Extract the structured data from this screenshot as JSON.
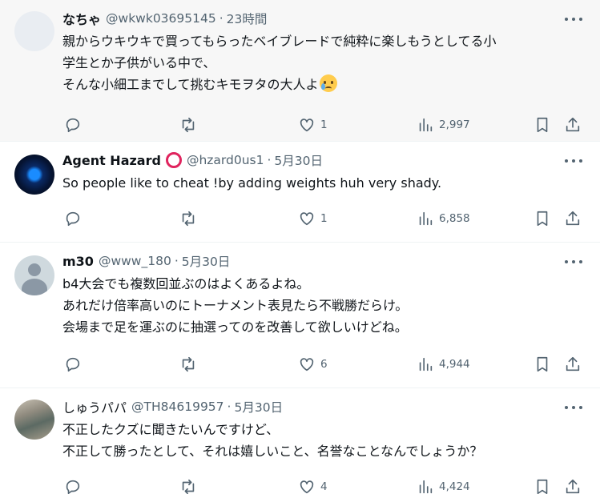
{
  "tweets": [
    {
      "name": "なちゃ",
      "handle": "@wkwk03695145",
      "time": "23時間",
      "lines": [
        "親からウキウキで買ってもらったベイブレードで純粋に楽しもうとしてる小",
        "学生とか子供がいる中で、",
        "そんな小細工までして挑むキモヲタの大人よ"
      ],
      "likes": "1",
      "views": "2,997",
      "emoji": "sad-tear-emoji"
    },
    {
      "name": "Agent Hazard",
      "handle": "@hzard0us1",
      "time": "5月30日",
      "lines": [
        "So people like to cheat !by adding weights huh very shady."
      ],
      "likes": "1",
      "views": "6,858"
    },
    {
      "name": "m30",
      "handle": "@www_180",
      "time": "5月30日",
      "lines": [
        "b4大会でも複数回並ぶのはよくあるよね。",
        "あれだけ倍率高いのにトーナメント表見たら不戦勝だらけ。",
        "会場まで足を運ぶのに抽選ってのを改善して欲しいけどね。"
      ],
      "likes": "6",
      "views": "4,944"
    },
    {
      "name": "しゅうパパ",
      "handle": "@TH84619957",
      "time": "5月30日",
      "lines": [
        "不正したクズに聞きたいんですけど、",
        "不正して勝ったとして、それは嬉しいこと、名誉なことなんでしょうか？"
      ],
      "likes": "4",
      "views": "4,424"
    }
  ],
  "separator": "·",
  "icons": [
    "reply-icon",
    "retweet-icon",
    "like-icon",
    "views-icon",
    "bookmark-icon",
    "share-icon",
    "more-icon"
  ],
  "colors": {
    "accent_ring": "#e0245e",
    "muted": "#536471",
    "highlight_bg": "#f7f7f7"
  }
}
